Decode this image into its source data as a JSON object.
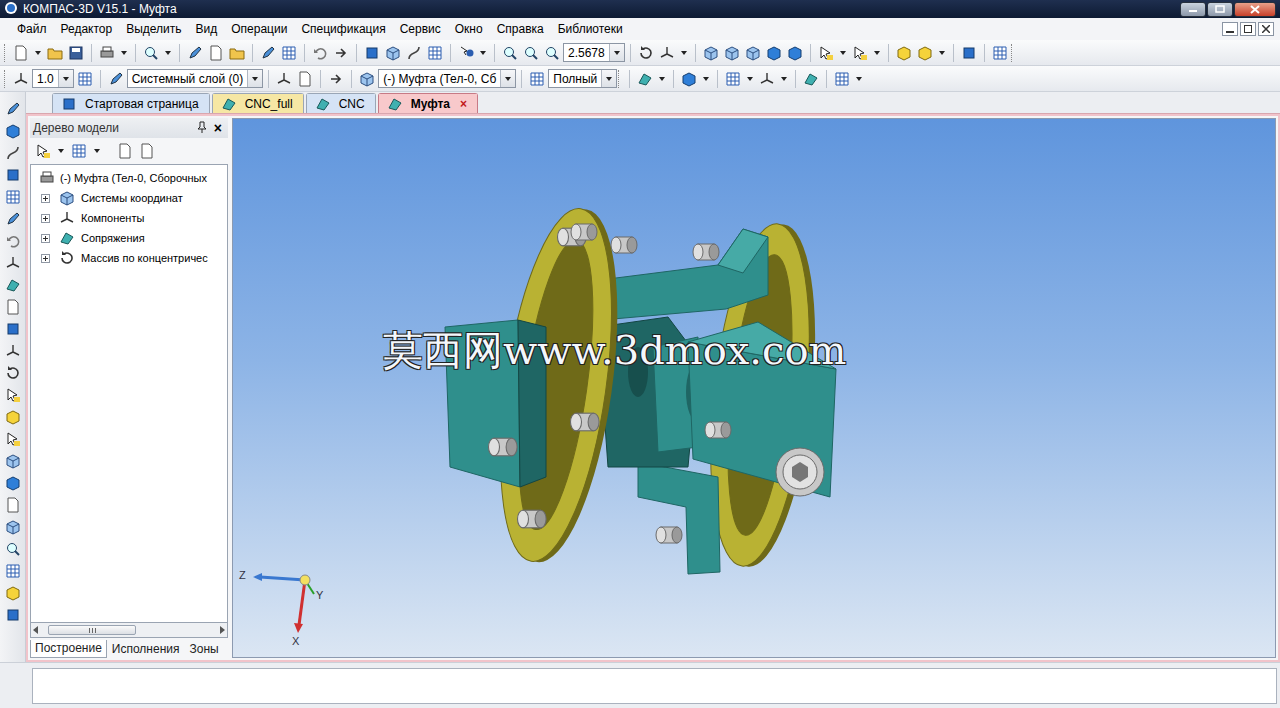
{
  "window": {
    "title": "КОМПАС-3D V15.1 - Муфта"
  },
  "menu": [
    "Файл",
    "Редактор",
    "Выделить",
    "Вид",
    "Операции",
    "Спецификация",
    "Сервис",
    "Окно",
    "Справка",
    "Библиотеки"
  ],
  "toolbar": {
    "zoom": "2.5678",
    "step": "1.0",
    "layer": "Системный слой (0)",
    "part": "(-) Муфта (Тел-0, Сб",
    "view": "Полный"
  },
  "tabs": [
    {
      "label": "Стартовая страница",
      "selected": false,
      "color": "#d5e3f5"
    },
    {
      "label": "CNC_full",
      "selected": false,
      "color": "#f6e7a4"
    },
    {
      "label": "CNC",
      "selected": false,
      "color": "#d5e3f5"
    },
    {
      "label": "Муфта",
      "selected": true,
      "color": "#f8c9cb",
      "close": "×"
    }
  ],
  "tree": {
    "title": "Дерево модели",
    "close": "×",
    "root": {
      "label": "(-) Муфта (Тел-0, Сборочных",
      "expanded": true
    },
    "items": [
      {
        "label": "Системы координат",
        "expanded": false
      },
      {
        "label": "Компоненты",
        "expanded": false
      },
      {
        "label": "Сопряжения",
        "expanded": false
      },
      {
        "label": "Массив по концентричес",
        "expanded": false
      }
    ]
  },
  "panel_tabs": [
    {
      "label": "Построение",
      "selected": true
    },
    {
      "label": "Исполнения",
      "selected": false
    },
    {
      "label": "Зоны",
      "selected": false
    }
  ],
  "viewport": {
    "watermark": "莫西网www.3dmox.com",
    "axes": {
      "z": "Z",
      "y": "Y",
      "x": "X"
    }
  }
}
